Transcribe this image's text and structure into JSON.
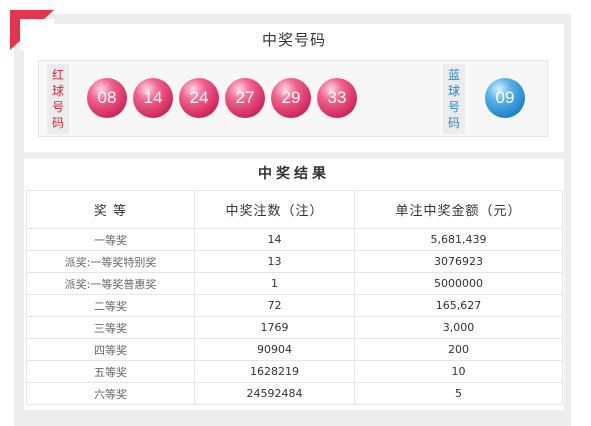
{
  "winning_numbers": {
    "title": "中奖号码",
    "red_label": [
      "红",
      "球",
      "号",
      "码"
    ],
    "blue_label": [
      "蓝",
      "球",
      "号",
      "码"
    ],
    "red_balls": [
      "08",
      "14",
      "24",
      "27",
      "29",
      "33"
    ],
    "blue_ball": "09"
  },
  "results": {
    "title": "中奖结果",
    "headers": [
      "奖 等",
      "中奖注数（注）",
      "单注中奖金额（元）"
    ],
    "rows": [
      [
        "一等奖",
        "14",
        "5,681,439"
      ],
      [
        "派奖:一等奖特别奖",
        "13",
        "3076923"
      ],
      [
        "派奖:一等奖普惠奖",
        "1",
        "5000000"
      ],
      [
        "二等奖",
        "72",
        "165,627"
      ],
      [
        "三等奖",
        "1769",
        "3,000"
      ],
      [
        "四等奖",
        "90904",
        "200"
      ],
      [
        "五等奖",
        "1628219",
        "10"
      ],
      [
        "六等奖",
        "24592484",
        "5"
      ]
    ]
  },
  "colors": {
    "red_ball": "#d0245a",
    "blue_ball": "#1f83c9",
    "red_label": "#d8253b",
    "blue_label": "#2a88c8",
    "corner_badge": "#e2374b",
    "background": "#ededed"
  }
}
